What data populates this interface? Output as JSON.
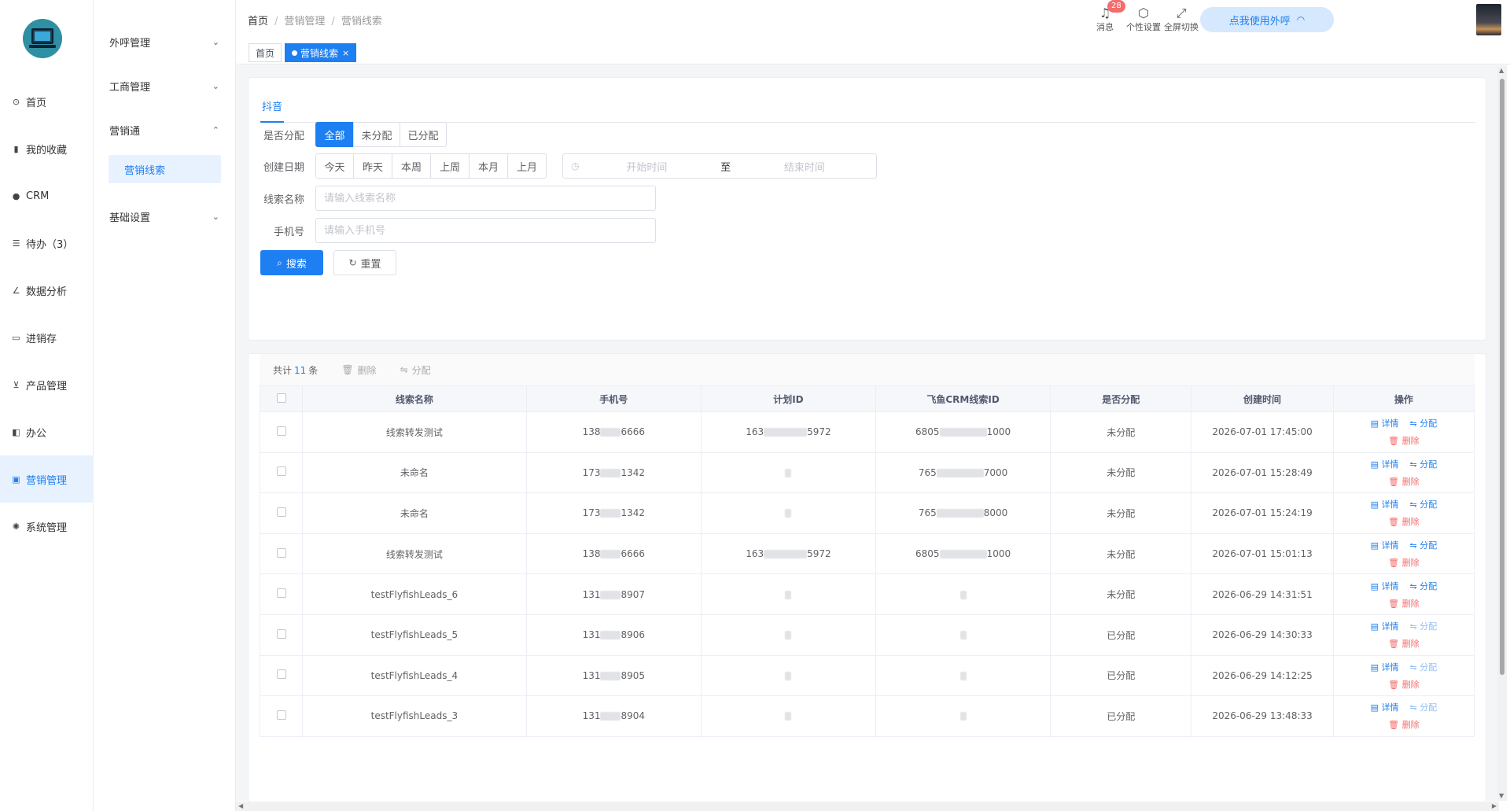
{
  "nav": [
    {
      "label": "首页",
      "icon": "dashboard-icon",
      "glyph": "⊙",
      "active": false
    },
    {
      "label": "我的收藏",
      "icon": "bookmark-icon",
      "glyph": "▮",
      "active": false
    },
    {
      "label": "CRM",
      "icon": "user-icon",
      "glyph": "●",
      "active": false
    },
    {
      "label": "待办（3）",
      "icon": "sliders-icon",
      "glyph": "☰",
      "active": false
    },
    {
      "label": "数据分析",
      "icon": "chart-icon",
      "glyph": "∠",
      "active": false
    },
    {
      "label": "进销存",
      "icon": "window-icon",
      "glyph": "▭",
      "active": false
    },
    {
      "label": "产品管理",
      "icon": "cart-icon",
      "glyph": "⊻",
      "active": false
    },
    {
      "label": "办公",
      "icon": "book-icon",
      "glyph": "◧",
      "active": false
    },
    {
      "label": "营销管理",
      "icon": "monitor-icon",
      "glyph": "▣",
      "active": true
    },
    {
      "label": "系统管理",
      "icon": "gear-icon",
      "glyph": "✺",
      "active": false
    }
  ],
  "subnav": {
    "items": [
      {
        "label": "外呼管理",
        "chevron": "⌄"
      },
      {
        "label": "工商管理",
        "chevron": "⌄"
      },
      {
        "label": "营销通",
        "chevron": "⌃"
      },
      {
        "label": "基础设置",
        "chevron": "⌄"
      }
    ],
    "child": "营销线索"
  },
  "header": {
    "breadcrumb": [
      "首页",
      "营销管理",
      "营销线索"
    ],
    "call_button": "点我使用外呼",
    "icons": [
      {
        "label": "消息",
        "name": "bell-icon",
        "glyph": "♫"
      },
      {
        "label": "个性设置",
        "name": "settings-icon",
        "glyph": "⬡"
      },
      {
        "label": "全屏切换",
        "name": "fullscreen-icon",
        "glyph": "⤢"
      }
    ],
    "badge": "28"
  },
  "tabs": {
    "home": "首页",
    "active": "营销线索",
    "close": "×"
  },
  "filter": {
    "platform_tab": "抖音",
    "assign_label": "是否分配",
    "assign_options": [
      "全部",
      "未分配",
      "已分配"
    ],
    "date_label": "创建日期",
    "date_options": [
      "今天",
      "昨天",
      "本周",
      "上周",
      "本月",
      "上月"
    ],
    "start_placeholder": "开始时间",
    "range_sep": "至",
    "end_placeholder": "结束时间",
    "name_label": "线索名称",
    "name_placeholder": "请输入线索名称",
    "phone_label": "手机号",
    "phone_placeholder": "请输入手机号",
    "search": "搜索",
    "reset": "重置"
  },
  "table": {
    "total_prefix": "共计",
    "total": "11",
    "total_suffix": "条",
    "delete": "删除",
    "assign": "分配",
    "columns": [
      "线索名称",
      "手机号",
      "计划ID",
      "飞鱼CRM线索ID",
      "是否分配",
      "创建时间",
      "操作"
    ],
    "rows": [
      {
        "name": "线索转发测试",
        "phone_a": "138",
        "phone_b": "6666",
        "plan_a": "163",
        "plan_b": "5972",
        "crm_a": "6805",
        "crm_b": "1000",
        "status": "未分配",
        "created": "2026-07-01 17:45:00"
      },
      {
        "name": "未命名",
        "phone_a": "173",
        "phone_b": "1342",
        "plan_a": "",
        "plan_b": "",
        "crm_a": "765",
        "crm_b": "7000",
        "status": "未分配",
        "created": "2026-07-01 15:28:49"
      },
      {
        "name": "未命名",
        "phone_a": "173",
        "phone_b": "1342",
        "plan_a": "",
        "plan_b": "",
        "crm_a": "765",
        "crm_b": "8000",
        "status": "未分配",
        "created": "2026-07-01 15:24:19"
      },
      {
        "name": "线索转发测试",
        "phone_a": "138",
        "phone_b": "6666",
        "plan_a": "163",
        "plan_b": "5972",
        "crm_a": "6805",
        "crm_b": "1000",
        "status": "未分配",
        "created": "2026-07-01 15:01:13"
      },
      {
        "name": "testFlyfishLeads_6",
        "phone_a": "131",
        "phone_b": "8907",
        "plan_a": "",
        "plan_b": "",
        "crm_a": "",
        "crm_b": "",
        "status": "未分配",
        "created": "2026-06-29 14:31:51"
      },
      {
        "name": "testFlyfishLeads_5",
        "phone_a": "131",
        "phone_b": "8906",
        "plan_a": "",
        "plan_b": "",
        "crm_a": "",
        "crm_b": "",
        "status": "已分配",
        "created": "2026-06-29 14:30:33"
      },
      {
        "name": "testFlyfishLeads_4",
        "phone_a": "131",
        "phone_b": "8905",
        "plan_a": "",
        "plan_b": "",
        "crm_a": "",
        "crm_b": "",
        "status": "已分配",
        "created": "2026-06-29 14:12:25"
      },
      {
        "name": "testFlyfishLeads_3",
        "phone_a": "131",
        "phone_b": "8904",
        "plan_a": "",
        "plan_b": "",
        "crm_a": "",
        "crm_b": "",
        "status": "已分配",
        "created": "2026-06-29 13:48:33"
      }
    ],
    "op_detail": "详情",
    "op_assign": "分配",
    "op_delete": "删除"
  },
  "colors": {
    "primary": "#1d7ff1",
    "unassigned": "#f56c6c",
    "assigned": "#67c23a"
  }
}
